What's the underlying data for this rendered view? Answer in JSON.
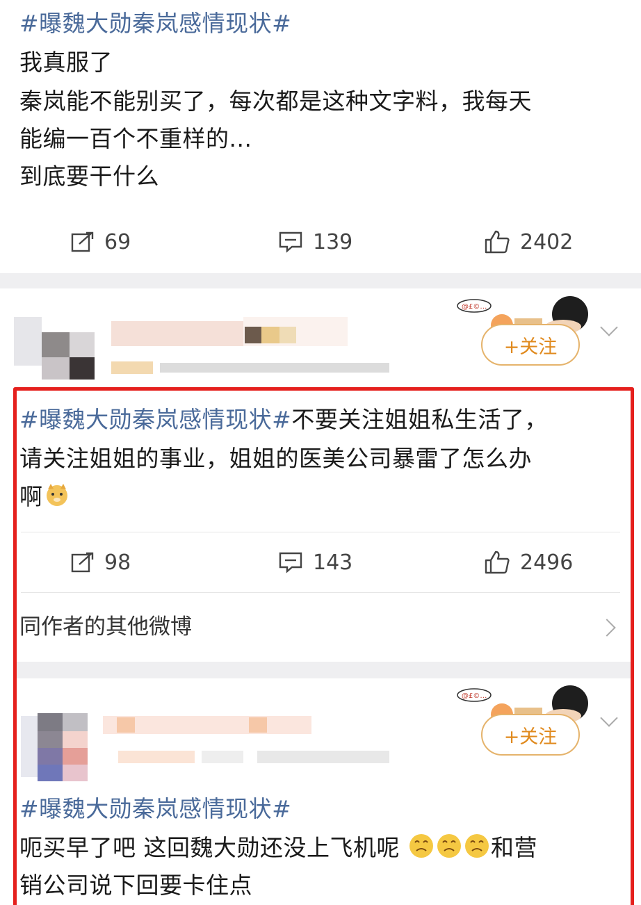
{
  "post1": {
    "lines": [
      "#曝魏大勋秦岚感情现状#",
      "我真服了",
      "秦岚能不能别买了，每次都是这种文字料，我每天",
      "能编一百个不重样的...",
      "到底要干什么"
    ],
    "repost_count": "69",
    "comment_count": "139",
    "like_count": "2402"
  },
  "post2": {
    "follow_label": "+关注",
    "hashtag": "#曝魏大勋秦岚感情现状#",
    "line1_rest": "不要关注姐姐私生活了，",
    "line2": "请关注姐姐的事业，姐姐的医美公司暴雷了怎么办",
    "line3": "啊",
    "emoji": "doge-emoji",
    "repost_count": "98",
    "comment_count": "143",
    "like_count": "2496",
    "more_link": "同作者的其他微博"
  },
  "post3": {
    "follow_label": "+关注",
    "hashtag": "#曝魏大勋秦岚感情现状#",
    "line2_a": "呃买早了吧 这回魏大勋还没上飞机呢",
    "line2_b": "和营",
    "line3": "销公司说下回要卡住点",
    "emoji": "crying-emoji"
  },
  "colors": {
    "hashtag": "#4a6a9a",
    "follow": "#e08a1e",
    "highlight_frame": "#e5201d"
  }
}
